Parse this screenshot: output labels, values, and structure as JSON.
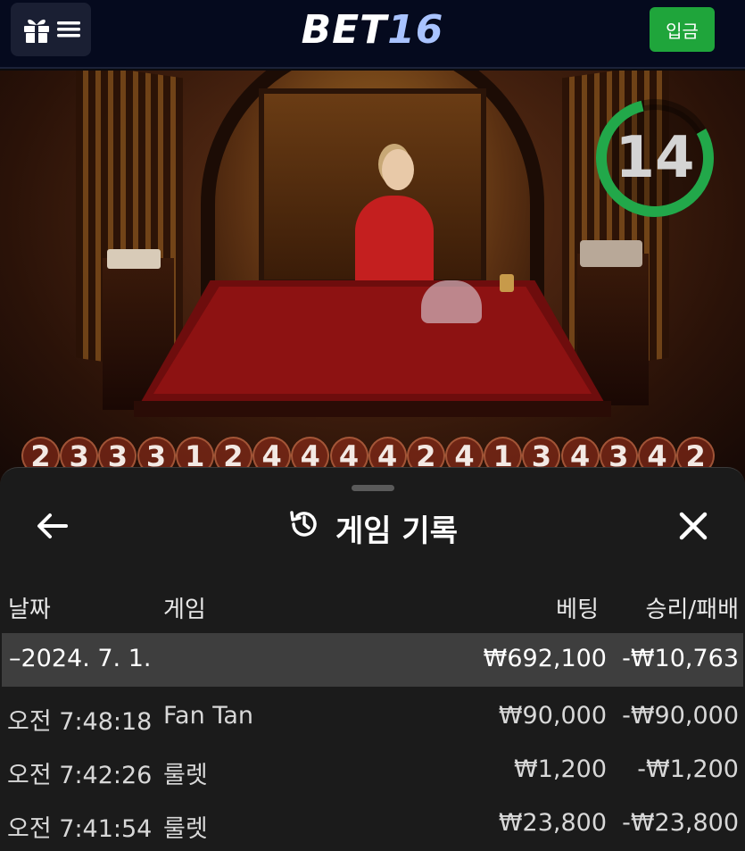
{
  "header": {
    "logo_text": "BET",
    "logo_number": "16",
    "deposit_label": "입금",
    "deposit_color": "#1fa53b",
    "menu_icons": [
      "gift-icon",
      "hamburger-icon"
    ]
  },
  "game": {
    "timer_value": "14",
    "timer_color": "#22a84a",
    "results": [
      "2",
      "3",
      "3",
      "3",
      "1",
      "2",
      "4",
      "4",
      "4",
      "4",
      "2",
      "4",
      "1",
      "3",
      "4",
      "3",
      "4",
      "2"
    ]
  },
  "history": {
    "title": "게임 기록",
    "title_icon": "history-icon",
    "back_icon": "arrow-left-icon",
    "close_icon": "close-icon",
    "columns": {
      "date": "날짜",
      "game": "게임",
      "bet": "베팅",
      "win_loss": "승리/패배"
    },
    "date_group": {
      "date": "–2024. 7. 1.",
      "bet": "₩692,100",
      "win_loss": "-₩10,763"
    },
    "rows": [
      {
        "time": "오전 7:48:18",
        "game": "Fan Tan",
        "bet": "₩90,000",
        "win_loss": "-₩90,000"
      },
      {
        "time": "오전 7:42:26",
        "game": "룰렛",
        "bet": "₩1,200",
        "win_loss": "-₩1,200"
      },
      {
        "time": "오전 7:41:54",
        "game": "룰렛",
        "bet": "₩23,800",
        "win_loss": "-₩23,800"
      }
    ]
  }
}
